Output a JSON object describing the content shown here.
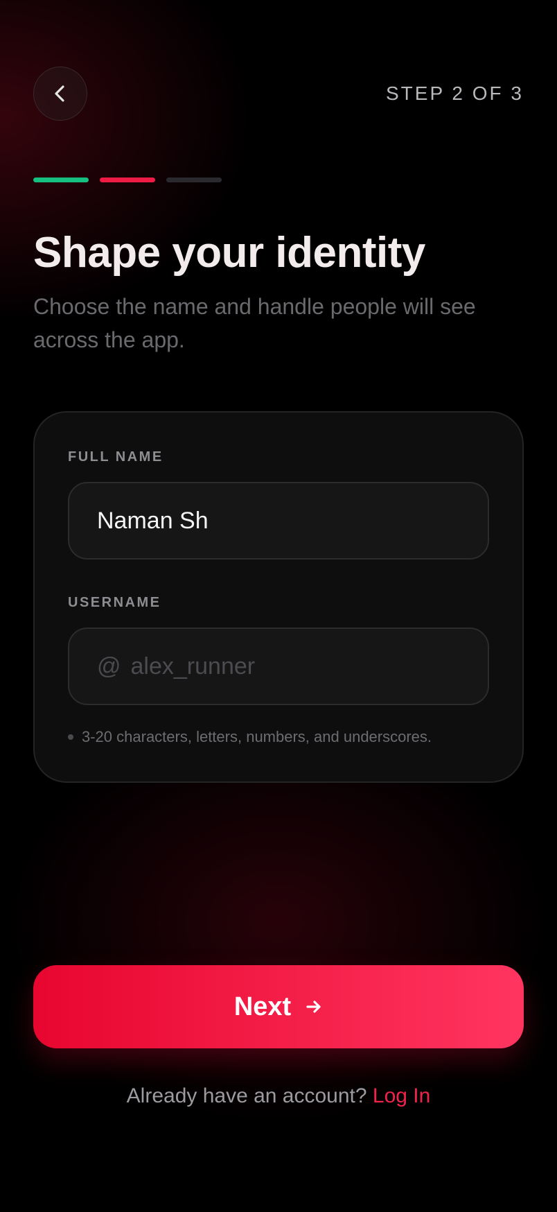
{
  "header": {
    "back_icon": "chevron-left-icon",
    "step_text": "STEP 2 OF 3"
  },
  "progress": {
    "total_steps": 3,
    "current_step": 2,
    "colors": [
      "#16c07f",
      "#ee1c45",
      "#2a2a2e"
    ]
  },
  "intro": {
    "title": "Shape your identity",
    "subtitle": "Choose the name and handle people will see across the app."
  },
  "form": {
    "full_name": {
      "label": "FULL NAME",
      "value": "Naman Sh"
    },
    "username": {
      "label": "USERNAME",
      "prefix": "@",
      "value": "",
      "placeholder": "alex_runner"
    },
    "hint": "3-20 characters, letters, numbers, and underscores."
  },
  "actions": {
    "next_label": "Next",
    "next_icon": "arrow-right-icon",
    "accent_gradient": [
      "#e8062f",
      "#ff3560"
    ]
  },
  "footer": {
    "prompt": "Already have an account?",
    "link": "Log In"
  }
}
